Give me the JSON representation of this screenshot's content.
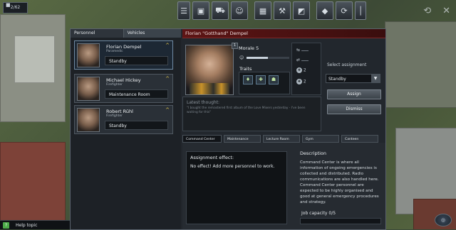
{
  "resource": {
    "icon": "person-icon",
    "value": "2/62"
  },
  "toolbar": {
    "buttons": [
      {
        "name": "menu",
        "glyph": "☰"
      },
      {
        "name": "buildings",
        "glyph": "▣"
      },
      {
        "name": "vehicles",
        "glyph": "⛟"
      },
      {
        "name": "personnel",
        "glyph": "👤"
      },
      {
        "name": "blueprint",
        "glyph": "▦"
      },
      {
        "name": "tools",
        "glyph": "⚒"
      },
      {
        "name": "map",
        "glyph": "◩"
      },
      {
        "name": "missions",
        "glyph": "◆"
      },
      {
        "name": "alarm",
        "glyph": "⟳"
      },
      {
        "name": "more",
        "glyph": "│"
      }
    ],
    "right_icons": [
      "⟲",
      "✕"
    ]
  },
  "tabs": {
    "personnel": "Personnel",
    "vehicles": "Vehicles"
  },
  "personnel": [
    {
      "name": "Florian Dempel",
      "role": "Paramedic",
      "status": "Standby"
    },
    {
      "name": "Michael Hickey",
      "role": "Firefighter",
      "status": "Maintenance Room"
    },
    {
      "name": "Robert Rühl",
      "role": "Firefighter",
      "status": "Standby"
    }
  ],
  "detail": {
    "header": "Florian \"Gotthand\" Dempel",
    "morale_label": "Morale 5",
    "morale_level": 0.5,
    "traits_label": "Traits",
    "traits": [
      "♦",
      "✚",
      "☗"
    ],
    "skills": [
      "2",
      "2"
    ],
    "assign_label": "Select assignment",
    "assign_value": "Standby",
    "assign_button": "Assign",
    "dismiss_button": "Dismiss",
    "thought_label": "Latest thought:",
    "thought_text": "\"I bought the remastered first album of the Love Mixers yesterday - I've been waiting for this\""
  },
  "room_tabs": [
    "Command Center",
    "Maintenance Room",
    "Lecture Room",
    "Gym",
    "Canteen"
  ],
  "room": {
    "effect_title": "Assignment effect:",
    "effect_body": "No effect! Add more personnel to work.",
    "desc_title": "Description",
    "desc_body": "Command Center is where all information of ongoing emergencies is collected and distributed. Radio communications are also handled here. Command Center personnel are expected to be highly organised and good at general emergency procedures and strategy.",
    "job_capacity": "Job capacity 0/5"
  },
  "help": {
    "label": "Help topic"
  }
}
